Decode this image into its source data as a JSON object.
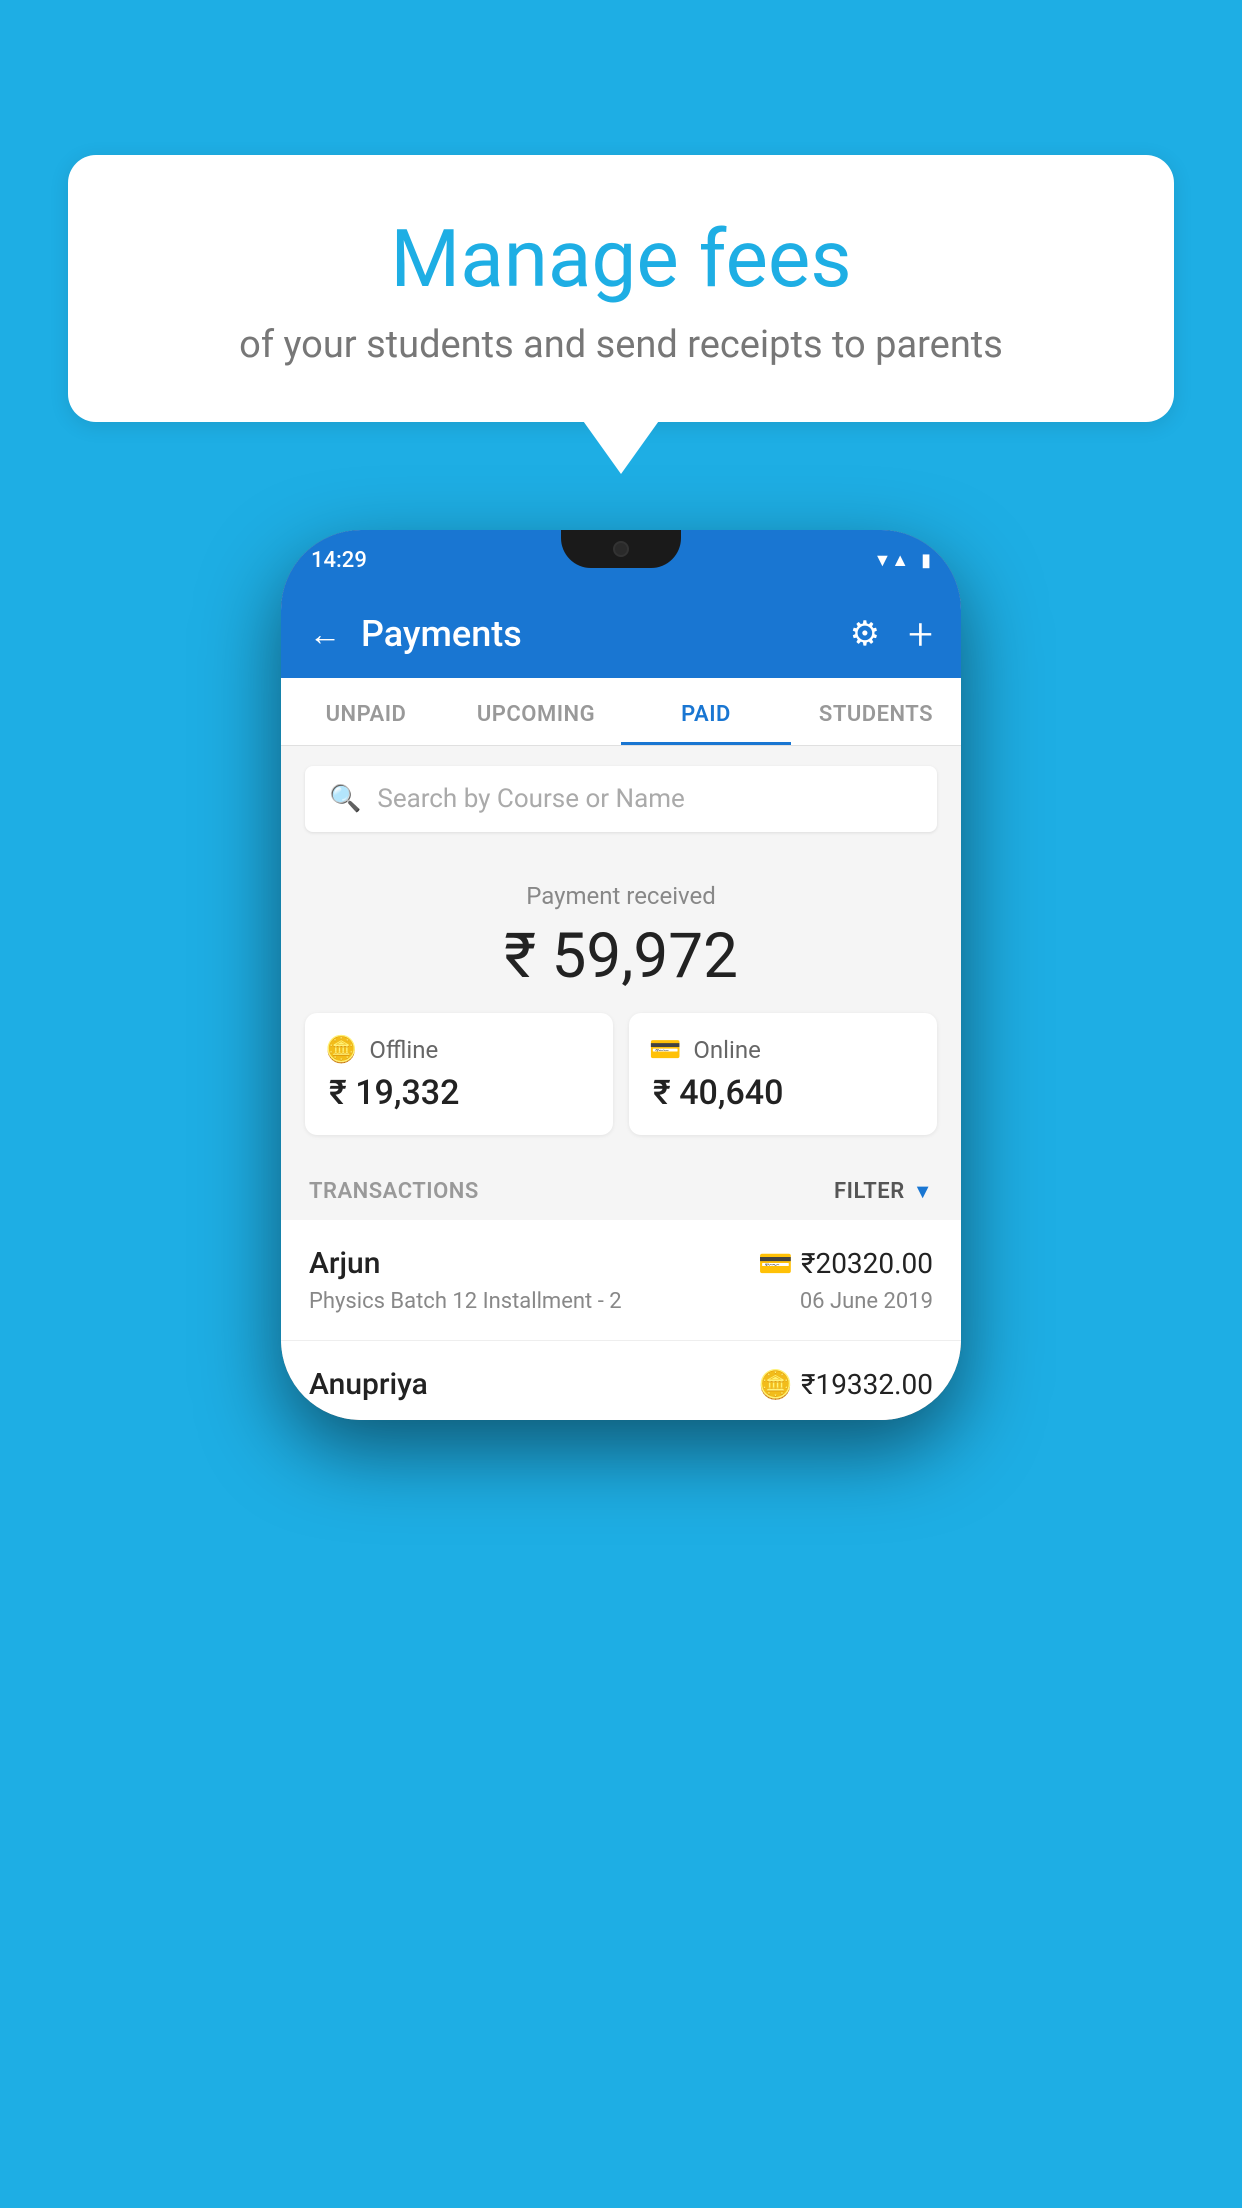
{
  "background_color": "#1EAEE4",
  "bubble": {
    "title": "Manage fees",
    "subtitle": "of your students and send receipts to parents"
  },
  "phone": {
    "status_bar": {
      "time": "14:29",
      "wifi": "▼",
      "signal": "▲",
      "battery": "▮"
    },
    "header": {
      "title": "Payments",
      "back_label": "←",
      "gear_label": "⚙",
      "plus_label": "+"
    },
    "tabs": [
      {
        "label": "UNPAID",
        "active": false
      },
      {
        "label": "UPCOMING",
        "active": false
      },
      {
        "label": "PAID",
        "active": true
      },
      {
        "label": "STUDENTS",
        "active": false
      }
    ],
    "search": {
      "placeholder": "Search by Course or Name"
    },
    "payment_summary": {
      "label": "Payment received",
      "total": "₹ 59,972",
      "offline_label": "Offline",
      "offline_amount": "₹ 19,332",
      "online_label": "Online",
      "online_amount": "₹ 40,640"
    },
    "transactions": {
      "section_label": "TRANSACTIONS",
      "filter_label": "FILTER",
      "rows": [
        {
          "name": "Arjun",
          "course": "Physics Batch 12 Installment - 2",
          "amount": "₹20320.00",
          "date": "06 June 2019",
          "payment_type": "online"
        },
        {
          "name": "Anupriya",
          "course": "",
          "amount": "₹19332.00",
          "date": "",
          "payment_type": "offline"
        }
      ]
    }
  }
}
